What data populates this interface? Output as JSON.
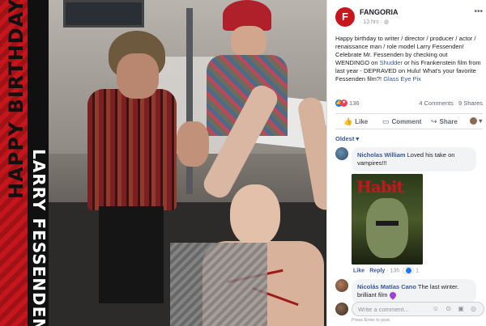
{
  "banner": {
    "happy_text": "HAPPY BIRTHDAY",
    "name_text": "LARRY FESSENDEN"
  },
  "post": {
    "page_name": "FANGORIA",
    "time": "· 13 hrs ·",
    "logo_letter": "F",
    "text_before_link1": "Happy birthday to writer / director / producer / actor / renaissance man / role model Larry Fessenden! Celebrate Mr. Fessenden by checking out WENDINGO on ",
    "link1": "Shudder",
    "text_after_link1": " or his Frankenstein film from last year - DEPRAVED on Hulu! What's your favorite Fessenden film?! ",
    "link2": "Glass Eye Pix",
    "reaction_count": "136",
    "comments_count": "4 Comments",
    "shares_count": "9 Shares"
  },
  "actions": {
    "like": "Like",
    "comment": "Comment",
    "share": "Share"
  },
  "sort_label": "Oldest ▾",
  "comments": [
    {
      "author": "Nicholas William",
      "text": " Loved his take on vampires!!!",
      "gif_title": "Habit",
      "like": "Like",
      "reply": "Reply",
      "time": "13h",
      "reaction_count": "1"
    },
    {
      "author": "Nicolás Matías Cano",
      "text": " The last winter. brilliant film"
    }
  ],
  "compose": {
    "placeholder": "Write a comment...",
    "hint": "Press Enter to post."
  },
  "icons": {
    "like_icon": "thumbs-up",
    "comment_icon": "speech-bubble",
    "share_icon": "share-arrow",
    "more_icon": "ellipsis",
    "emoji_icons": "☺ ⊙ ▣ ◎"
  },
  "colors": {
    "brand_red": "#c8161d",
    "link_blue": "#385898",
    "fb_blue": "#1877f2"
  }
}
